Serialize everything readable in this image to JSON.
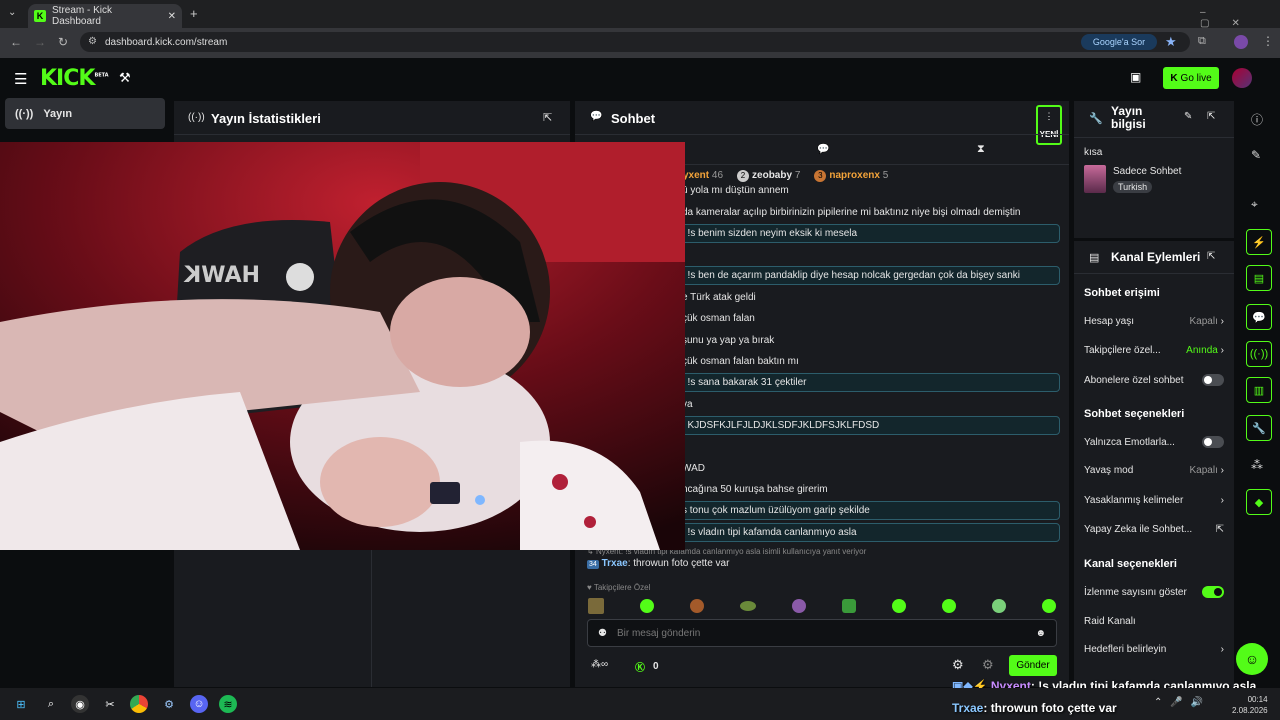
{
  "browser": {
    "tab_title": "Stream - Kick Dashboard",
    "url": "dashboard.kick.com/stream",
    "google_ask": "Google'a Sor"
  },
  "header": {
    "logo": "KICK",
    "beta": "BETA",
    "go_live": "Go live"
  },
  "sidenav": {
    "selected": "Yayın"
  },
  "stats": {
    "title": "Yayın İstatistikleri"
  },
  "chat": {
    "title": "Sohbet",
    "new_label": "YENİ",
    "top_chatters": [
      {
        "name": "yxent",
        "count": "46"
      },
      {
        "name": "zeobaby",
        "count": "7",
        "rank": "2"
      },
      {
        "name": "naproxenx",
        "count": "5",
        "rank": "3"
      }
    ],
    "messages": [
      "ü yola mı düştün annem",
      "da kameralar açılıp birbirinizin pipilerine mi baktınız niye bişi olmadı demiştin",
      ": !s benim sizden neyim eksik ki mesela",
      ": !s ben de açarım pandaklip diye hesap nolcak gergedan çok da bişey sanki",
      "e Türk atak geldi",
      "çük osman falan",
      "şunu ya yap ya bırak",
      "çük osman falan baktın mı",
      ": !s sana bakarak 31 çektiler",
      "va",
      ": KJDSFKJLFJLDJKLSDFJKLDFSJKLFDSD",
      "WAD",
      "ncağına 50 kuruşa bahse girerim",
      "s tonu çok mazlum üzülüyom garip şekilde",
      ": !s vladın tipi kafamda canlanmıyo asla"
    ],
    "reply_note": "Nyxent: !s vladın tipi kafamda canlanmıyo asla isimli kullanıcıya yanıt veriyor",
    "last_badge": "34",
    "last_user": "Trxae",
    "last_text": ": throwun foto çette var",
    "followers_label": "Takipçilere Özel",
    "placeholder": "Bir mesaj gönderin",
    "points": "0",
    "send": "Gönder"
  },
  "info": {
    "title": "Yayın bilgisi",
    "short": "kısa",
    "category": "Sadece Sohbet",
    "tag": "Turkish"
  },
  "kanal": {
    "title": "Kanal Eylemleri",
    "chat_access": "Sohbet erişimi",
    "account_age": "Hesap yaşı",
    "account_age_val": "Kapalı",
    "followers_only": "Takipçilere özel...",
    "followers_only_val": "Anında",
    "subs_only": "Abonelere özel sohbet",
    "chat_options": "Sohbet seçenekleri",
    "emotes_only": "Yalnızca Emotlarla...",
    "slow_mode": "Yavaş mod",
    "slow_mode_val": "Kapalı",
    "banned_words": "Yasaklanmış kelimeler",
    "ai_chat": "Yapay Zeka ile Sohbet...",
    "channel_options": "Kanal seçenekleri",
    "show_viewers": "İzlenme sayısını göster",
    "raid": "Raid Kanalı",
    "goals": "Hedefleri belirleyin"
  },
  "overlay": {
    "line1_user": "Nyxent",
    "line1_text": ": !s vladın tipi kafamda canlanmıyo asla",
    "line2_user": "Trxae",
    "line2_text": ": throwun foto çette var"
  },
  "taskbar": {
    "time": "00:14",
    "date": "2.08.2026"
  },
  "colors": {
    "accent": "#53fc18",
    "panel": "#191b1f",
    "highlight": "#2c5d6b"
  }
}
